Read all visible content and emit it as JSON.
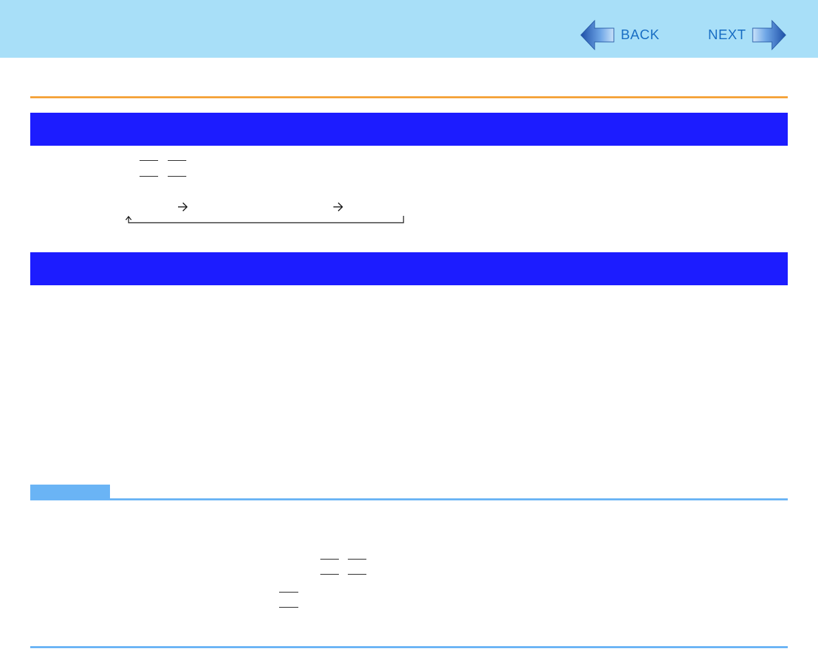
{
  "nav": {
    "back_label": "BACK",
    "next_label": "NEXT"
  },
  "colors": {
    "header_bg": "#a8dff8",
    "section_bar": "#1c1cff",
    "accent_rule": "#f5a33a",
    "note_rule": "#6ab4f5",
    "nav_text": "#1a6fc4"
  },
  "icons": [
    "back-arrow-icon",
    "next-arrow-icon",
    "right-arrow-icon",
    "loop-arrow-icon"
  ]
}
